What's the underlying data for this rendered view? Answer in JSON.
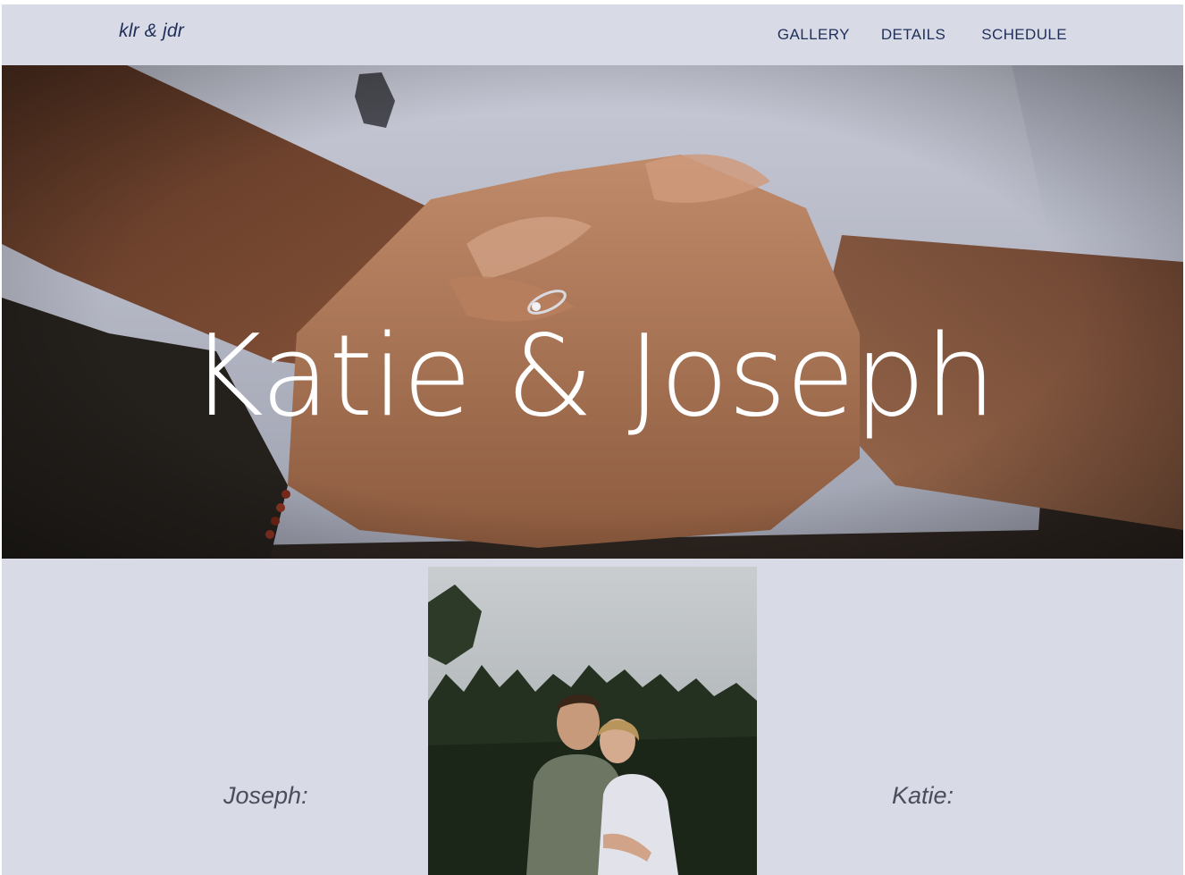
{
  "header": {
    "brand": "klr & jdr",
    "nav": [
      {
        "label": "GALLERY"
      },
      {
        "label": "DETAILS"
      },
      {
        "label": "SCHEDULE"
      }
    ]
  },
  "hero": {
    "title": "Katie & Joseph"
  },
  "profiles": {
    "left_label": "Joseph:",
    "right_label": "Katie:"
  },
  "colors": {
    "background": "#d8dae6",
    "text_accent": "#1f2f5a",
    "hero_title": "#ffffff"
  }
}
